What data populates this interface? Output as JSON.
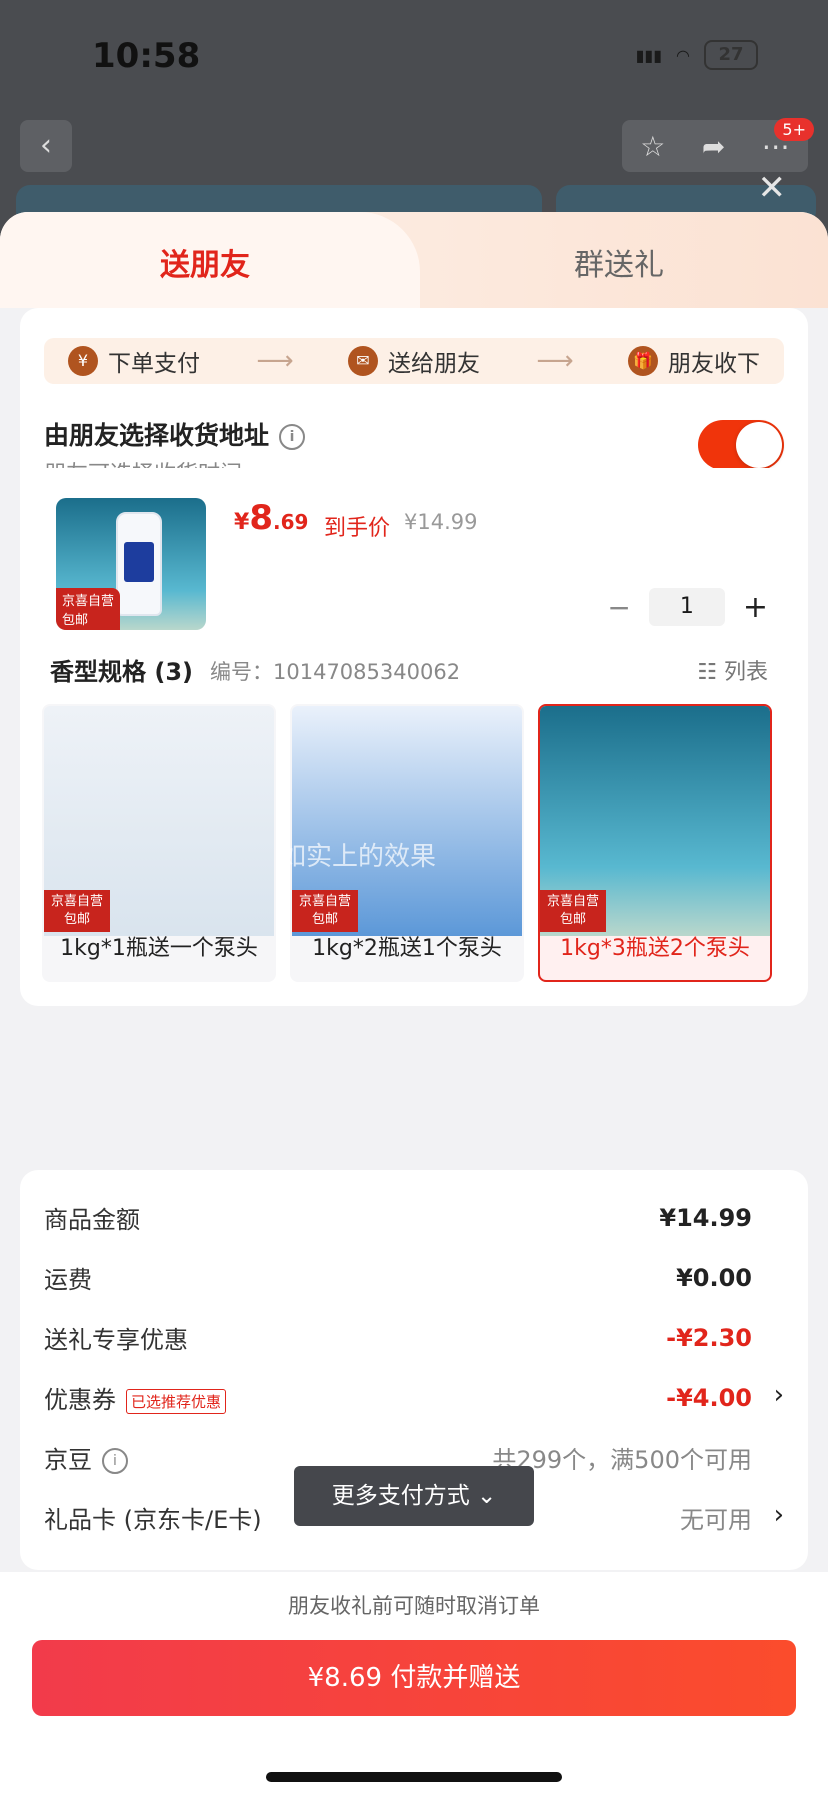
{
  "status": {
    "time": "10:58",
    "battery": "27"
  },
  "background_nav": {
    "badge": "5+"
  },
  "tabs": {
    "left": "送朋友",
    "right": "群送礼"
  },
  "steps": [
    {
      "icon": "¥",
      "label": "下单支付"
    },
    {
      "icon": "✉",
      "label": "送给朋友"
    },
    {
      "icon": "🎁",
      "label": "朋友收下"
    }
  ],
  "address": {
    "title": "由朋友选择收货地址",
    "subtitle": "朋友可选择收货时间",
    "toggle_on": true
  },
  "product": {
    "price_symbol": "¥",
    "price_int": "8",
    "price_dec": ".69",
    "price_label": "到手价",
    "original_price": "¥14.99",
    "quantity": "1",
    "thumb_tags": [
      "京喜自营",
      "包邮"
    ]
  },
  "spec": {
    "title": "香型规格 (3)",
    "code": "编号：10147085340062",
    "list_label": "列表",
    "options": [
      {
        "label": "1kg*1瓶送一个泵头",
        "tag1": "京喜自营",
        "tag2": "包邮",
        "selected": false
      },
      {
        "label": "1kg*2瓶送1个泵头",
        "tag1": "京喜自营",
        "tag2": "包邮",
        "selected": false
      },
      {
        "label": "1kg*3瓶送2个泵头",
        "tag1": "京喜自营",
        "tag2": "包邮",
        "selected": true
      }
    ],
    "watermark": "如实上的效果"
  },
  "summary": {
    "goods_amount_label": "商品金额",
    "goods_amount": "¥14.99",
    "shipping_label": "运费",
    "shipping": "¥0.00",
    "gift_discount_label": "送礼专享优惠",
    "gift_discount": "-¥2.30",
    "coupon_label": "优惠券",
    "coupon_tag": "已选推荐优惠",
    "coupon": "-¥4.00",
    "jingdou_label": "京豆",
    "jingdou": "共299个，满500个可用",
    "giftcard_label": "礼品卡 (京东卡/E卡)",
    "giftcard": "无可用"
  },
  "more_pay": "更多支付方式 ⌄",
  "footer": {
    "note": "朋友收礼前可随时取消订单",
    "pay_button": "¥8.69 付款并赠送"
  }
}
